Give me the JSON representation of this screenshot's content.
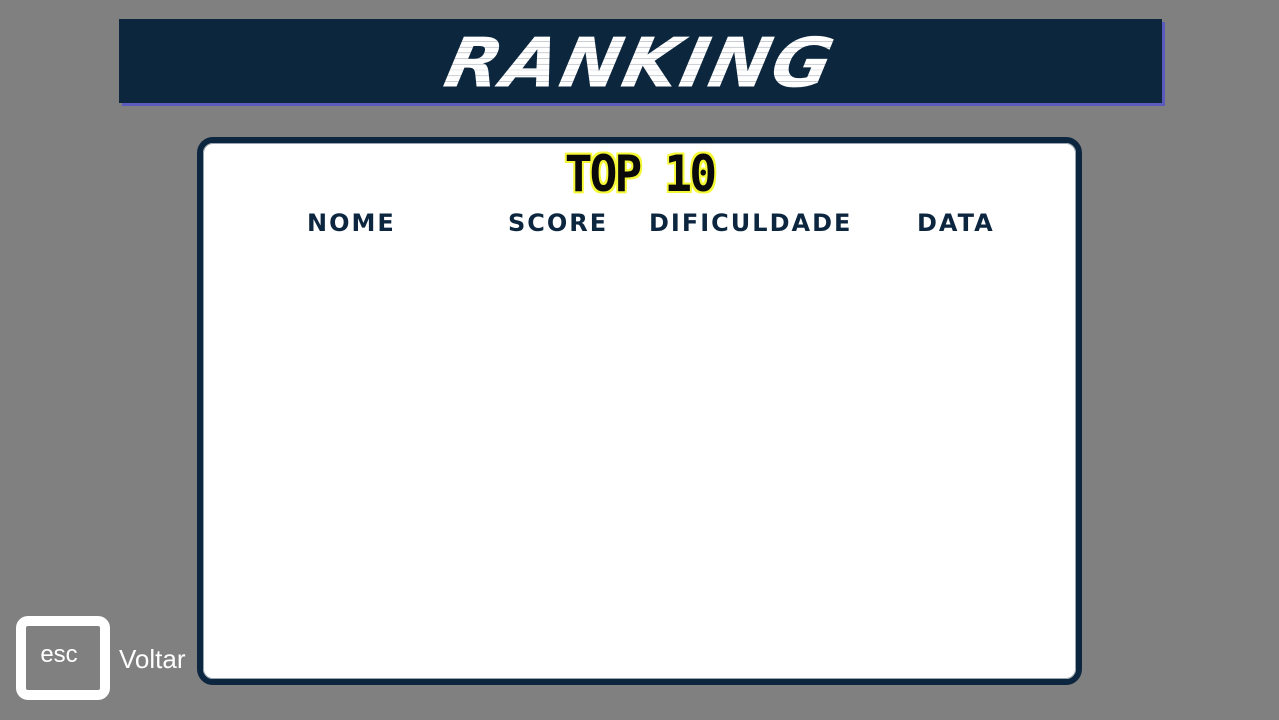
{
  "header": {
    "title": "RANKING"
  },
  "panel": {
    "title": "TOP 10",
    "columns": {
      "name": "NOME",
      "score": "SCORE",
      "difficulty": "DIFICULDADE",
      "date": "DATA"
    },
    "rows": []
  },
  "footer": {
    "esc_key": "esc",
    "back_label": "Voltar"
  },
  "colors": {
    "background": "#808080",
    "banner": "#0b263d",
    "banner_shadow": "#5b5bbd",
    "panel_border": "#0d2640",
    "top10_outline": "#f4f735"
  }
}
